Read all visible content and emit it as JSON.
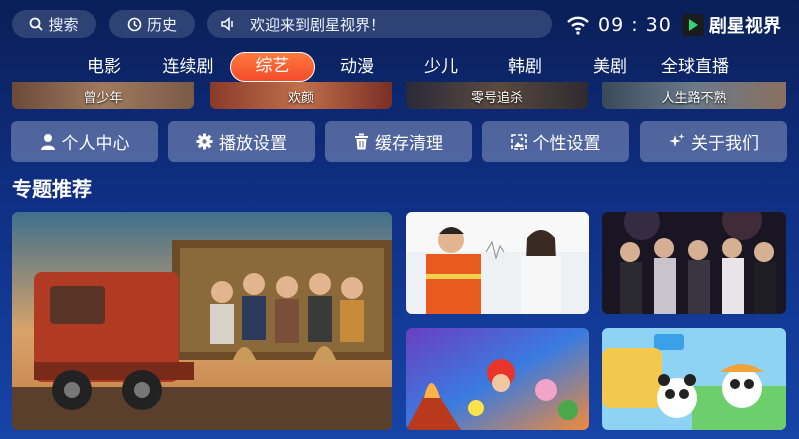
{
  "topbar": {
    "search_label": "搜索",
    "history_label": "历史",
    "notice": "欢迎来到剧星视界！",
    "clock": "09 : 30",
    "brand": "剧星视界"
  },
  "tabs": [
    {
      "label": "电影"
    },
    {
      "label": "连续剧"
    },
    {
      "label": "综艺",
      "active": true
    },
    {
      "label": "动漫"
    },
    {
      "label": "少儿"
    },
    {
      "label": "韩剧"
    },
    {
      "label": "美剧"
    },
    {
      "label": "全球直播"
    }
  ],
  "strip": [
    {
      "title": "曾少年"
    },
    {
      "title": "欢颜"
    },
    {
      "title": "零号追杀"
    },
    {
      "title": "人生路不熟"
    }
  ],
  "functions": [
    {
      "label": "个人中心",
      "icon": "person-icon"
    },
    {
      "label": "播放设置",
      "icon": "gear-icon"
    },
    {
      "label": "缓存清理",
      "icon": "trash-icon"
    },
    {
      "label": "个性设置",
      "icon": "image-icon"
    },
    {
      "label": "关于我们",
      "icon": "sparkle-icon"
    }
  ],
  "section": {
    "title": "专题推荐"
  },
  "colors": {
    "accent": "#f24b2a",
    "bg_top": "#0a1f57",
    "bg_bottom": "#1644a8"
  }
}
